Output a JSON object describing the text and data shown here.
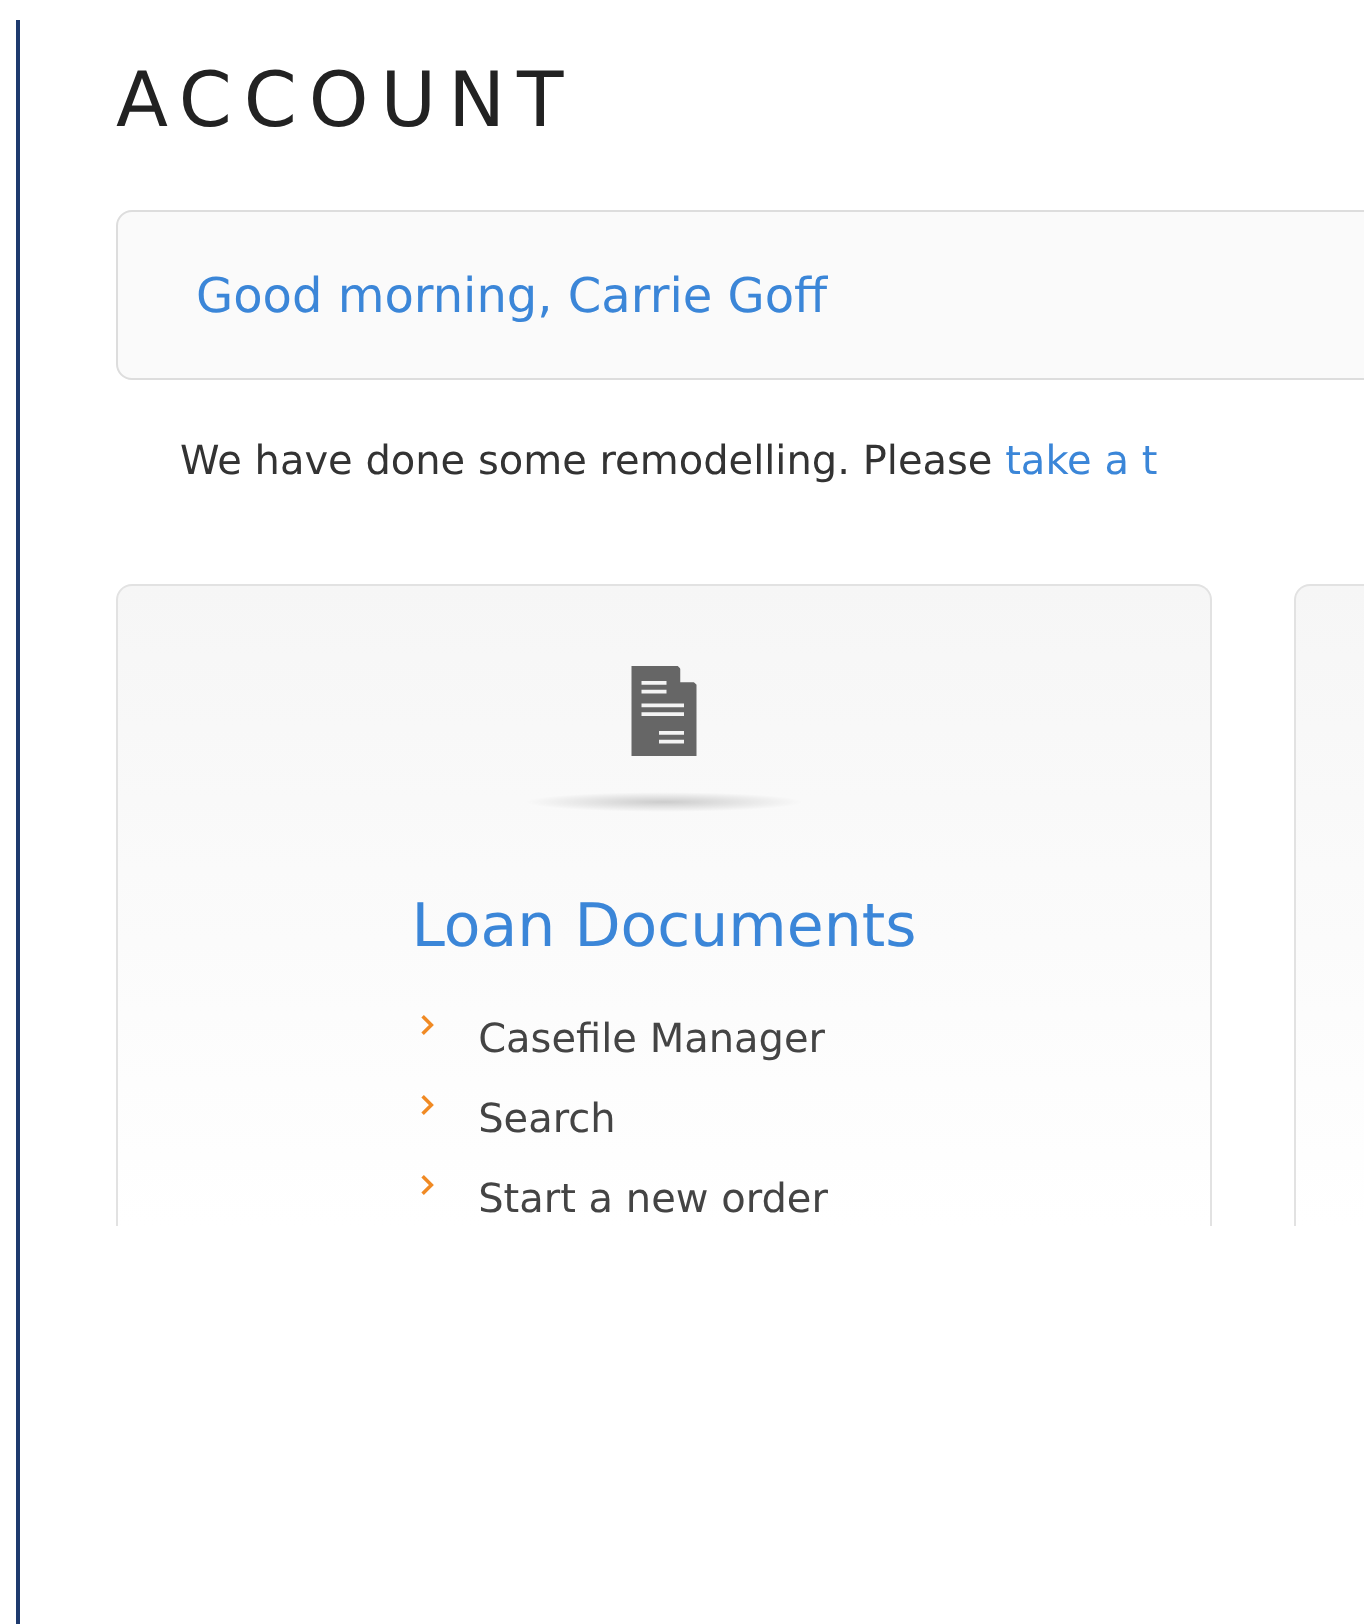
{
  "page": {
    "title": "ACCOUNT"
  },
  "greeting": "Good morning, Carrie Goff",
  "notice": {
    "text": "We have done some remodelling. Please ",
    "link": "take a t"
  },
  "cards": [
    {
      "kind": "feature",
      "title": "Loan Documents",
      "links": [
        "Casefile Manager",
        "Search",
        "Start a new order"
      ]
    },
    {
      "kind": "cut"
    }
  ]
}
